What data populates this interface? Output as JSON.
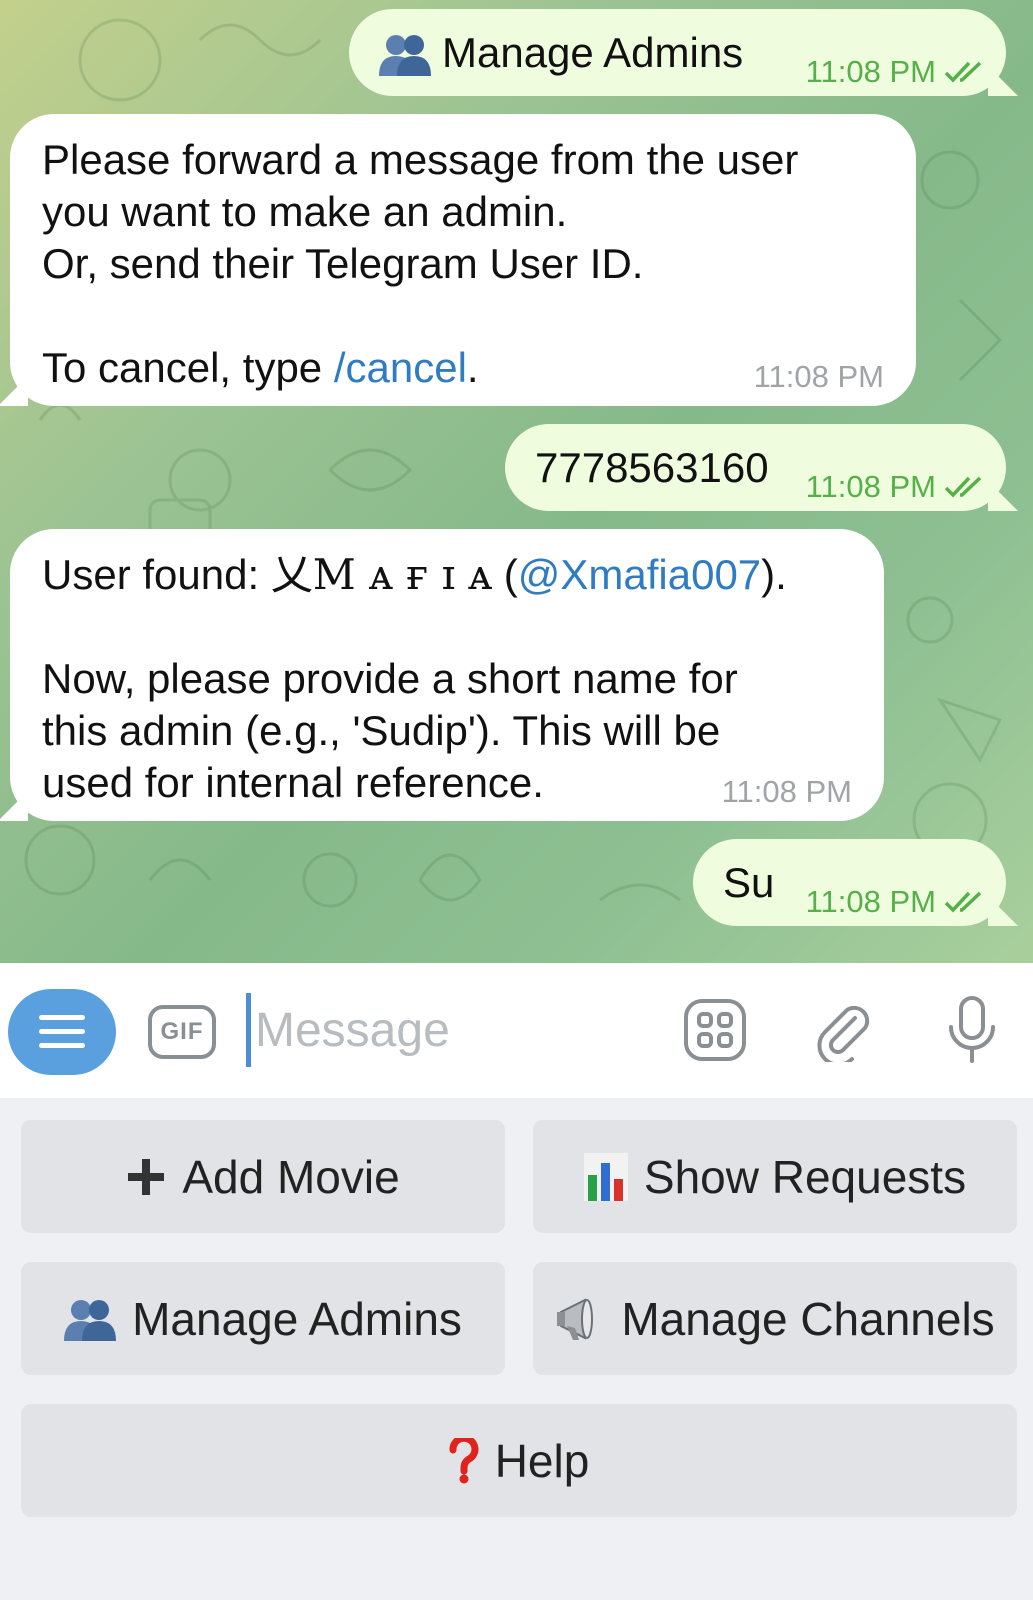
{
  "messages": [
    {
      "dir": "out",
      "icon": "admins-icon",
      "text": "Manage Admins",
      "time": "11:08 PM"
    },
    {
      "dir": "in",
      "lines": [
        "Please forward a message from the user",
        "you want to make an admin.",
        "Or, send their Telegram User ID.",
        "",
        "To cancel, type "
      ],
      "link": "/cancel",
      "after": ".",
      "time": "11:08 PM"
    },
    {
      "dir": "out",
      "text": "7778563160",
      "time": "11:08 PM"
    },
    {
      "dir": "in",
      "prefix": "User found: ",
      "name": "乂M ᴀ ғ ɪ ᴀ",
      "open": " (",
      "link": "@Xmafia007",
      "close": ").",
      "lines": [
        "",
        "Now, please provide a short name for",
        "this admin (e.g., 'Sudip'). This will be",
        "used for internal reference."
      ],
      "time": "11:08 PM"
    },
    {
      "dir": "out",
      "text": "Su",
      "time": "11:08 PM"
    }
  ],
  "input": {
    "placeholder": "Message",
    "gif_label": "GIF"
  },
  "keyboard": {
    "buttons": [
      {
        "label": "Add Movie",
        "icon": "plus-icon"
      },
      {
        "label": "Show Requests",
        "icon": "bar-chart-icon"
      },
      {
        "label": "Manage Admins",
        "icon": "admins-icon"
      },
      {
        "label": "Manage Channels",
        "icon": "megaphone-icon"
      },
      {
        "label": "Help",
        "icon": "question-icon"
      }
    ]
  },
  "colors": {
    "link": "#2f7cc2",
    "outgoing_bubble": "#effdde",
    "check_marks": "#55b04a",
    "menu_button": "#5aa0de"
  }
}
